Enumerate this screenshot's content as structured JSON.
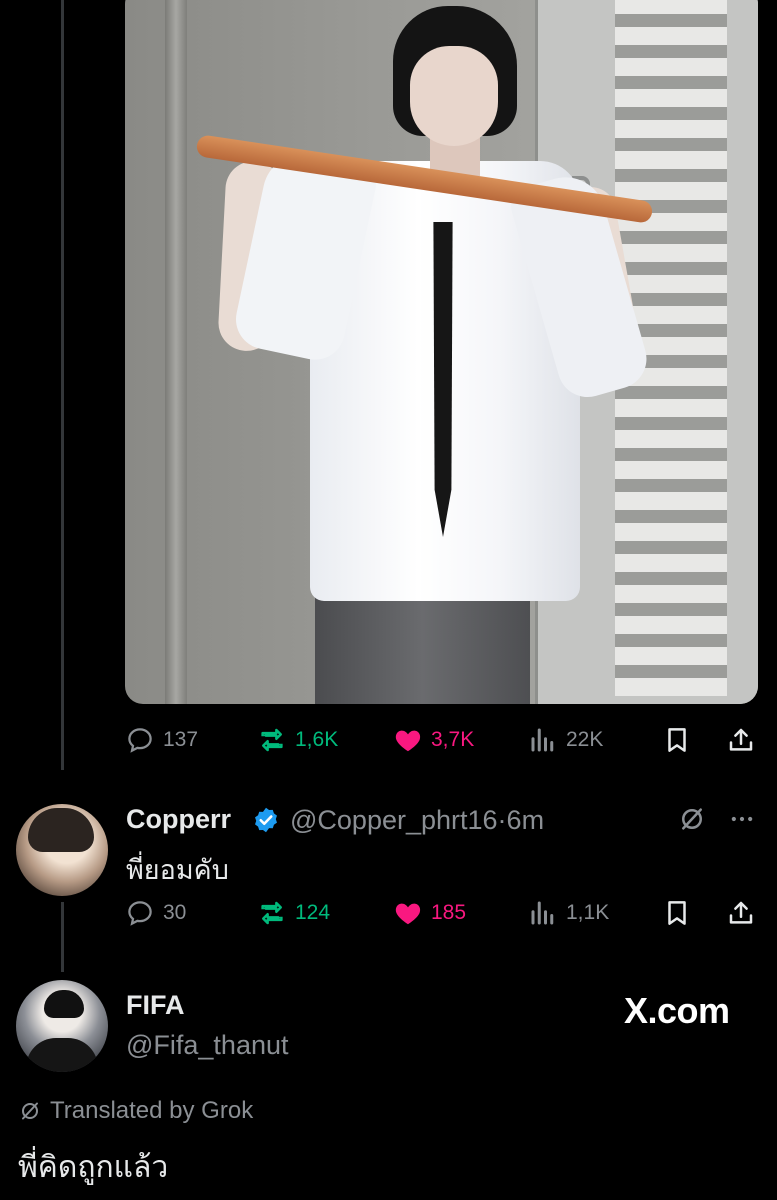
{
  "post": {
    "stats": {
      "replies": "137",
      "reposts": "1,6K",
      "likes": "3,7K",
      "views": "22K"
    }
  },
  "reply": {
    "name": "Copperr",
    "handle": "@Copper_phrt16",
    "separator": "·",
    "time": "6m",
    "text": "พี่ยอมคับ",
    "stats": {
      "replies": "30",
      "reposts": "124",
      "likes": "185",
      "views": "1,1K"
    }
  },
  "quoted": {
    "name": "FIFA",
    "handle": "@Fifa_thanut",
    "watermark": "X.com",
    "translated_label": "Translated by Grok",
    "text": "พี่คิดถูกแล้ว"
  },
  "icons": {
    "reply": "speech-bubble-icon",
    "repost": "repost-arrows-icon",
    "like": "heart-icon",
    "views": "bar-chart-icon",
    "bookmark": "bookmark-icon",
    "share": "share-icon",
    "verified": "verified-badge-icon",
    "grok": "grok-icon",
    "more": "more-dots-icon"
  },
  "colors": {
    "background": "#000000",
    "text": "#e7e9ea",
    "muted": "#8b8f94",
    "repost_green": "#00ba7c",
    "like_pink": "#f91880",
    "verified_blue": "#1d9bf0"
  }
}
